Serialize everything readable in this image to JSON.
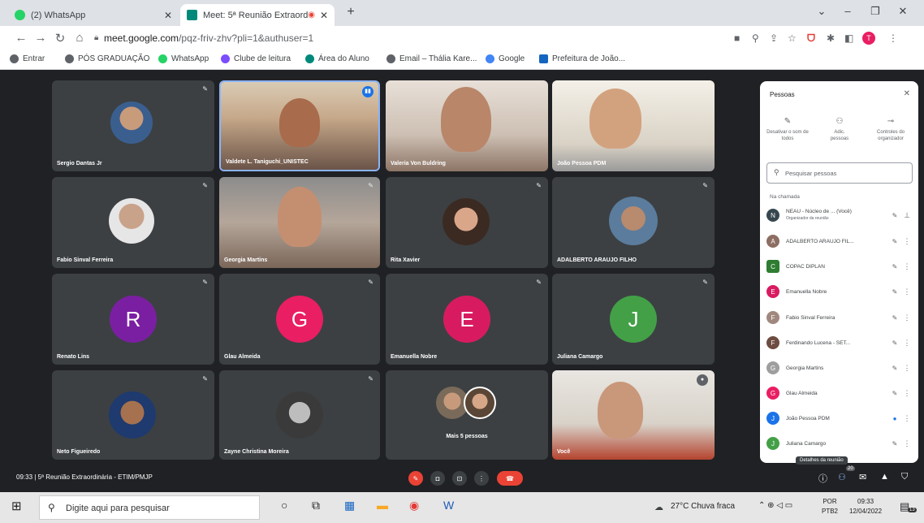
{
  "tabs": [
    {
      "title": "(2) WhatsApp",
      "favicon": "whatsapp-icon",
      "color": "#25d366",
      "active": false
    },
    {
      "title": "Meet: 5ª Reunião Extraordin",
      "favicon": "meet-icon",
      "color": "#00897b",
      "active": true
    }
  ],
  "address": {
    "domain": "meet.google.com",
    "path": "/pqz-friv-zhv?pli=1&authuser=1"
  },
  "bookmarks": [
    "Entrar",
    "PÓS GRADUAÇÃO",
    "WhatsApp",
    "Clube de leitura",
    "Área do Aluno",
    "Email – Thália Kare...",
    "Google",
    "Prefeitura de João..."
  ],
  "participants_grid": [
    {
      "name": "Sergio Dantas Jr",
      "type": "photo"
    },
    {
      "name": "Valdete L. Taniguchi_UNISTEC",
      "type": "video"
    },
    {
      "name": "Valeria Von Buldring",
      "type": "video"
    },
    {
      "name": "João Pessoa PDM",
      "type": "video"
    },
    {
      "name": "Fabio Sinval Ferreira",
      "type": "photo"
    },
    {
      "name": "Georgia Martins",
      "type": "video"
    },
    {
      "name": "Rita Xavier",
      "type": "photo"
    },
    {
      "name": "ADALBERTO ARAUJO FILHO",
      "type": "photo"
    },
    {
      "name": "Renato Lins",
      "type": "letter",
      "letter": "R",
      "color": "#7b1fa2"
    },
    {
      "name": "Glau Almeida",
      "type": "letter",
      "letter": "G",
      "color": "#e91e63"
    },
    {
      "name": "Emanuella Nobre",
      "type": "letter",
      "letter": "E",
      "color": "#d81b60"
    },
    {
      "name": "Juliana Camargo",
      "type": "letter",
      "letter": "J",
      "color": "#43a047"
    },
    {
      "name": "Neto Figueiredo",
      "type": "photo"
    },
    {
      "name": "Zayne Christina Moreira",
      "type": "photo"
    },
    {
      "name": "Mais 5 pessoas",
      "type": "group"
    },
    {
      "name": "Você",
      "type": "video"
    }
  ],
  "panel": {
    "title": "Pessoas",
    "actions": [
      "Desativar o som de todos",
      "Adic. pessoas",
      "Controles do organizador"
    ],
    "search_placeholder": "Pesquisar pessoas",
    "section": "Na chamada",
    "people": [
      {
        "name": "NEAU - Núcleo de ... (Você)",
        "sub": "Organizador da reunião",
        "color": "#37474f",
        "letter": "N"
      },
      {
        "name": "ADALBERTO ARAUJO FIL...",
        "color": "#8d6e63",
        "letter": "A"
      },
      {
        "name": "COPAC DIPLAN",
        "color": "#2e7d32",
        "letter": "C"
      },
      {
        "name": "Emanuella Nobre",
        "color": "#d81b60",
        "letter": "E"
      },
      {
        "name": "Fabio Sinval Ferreira",
        "color": "#a1887f",
        "letter": "F"
      },
      {
        "name": "Ferdinando Lucena - SET...",
        "color": "#6d4c41",
        "letter": "F"
      },
      {
        "name": "Georgia Martins",
        "color": "#9e9e9e",
        "letter": "G"
      },
      {
        "name": "Glau Almeida",
        "color": "#e91e63",
        "letter": "G"
      },
      {
        "name": "João Pessoa PDM",
        "color": "#1a73e8",
        "letter": "J"
      },
      {
        "name": "Juliana Camargo",
        "color": "#43a047",
        "letter": "J"
      }
    ],
    "tooltip": "Detalhes da reunião"
  },
  "bottom": {
    "time": "09:33",
    "meeting": "5ª Reunião Extraordinária - ETIM/PMJP",
    "badge": "20"
  },
  "taskbar": {
    "search": "Digite aqui para pesquisar",
    "weather": "27°C Chuva fraca",
    "lang1": "POR",
    "lang2": "PTB2",
    "time": "09:33",
    "date": "12/04/2022",
    "notif": "13"
  }
}
